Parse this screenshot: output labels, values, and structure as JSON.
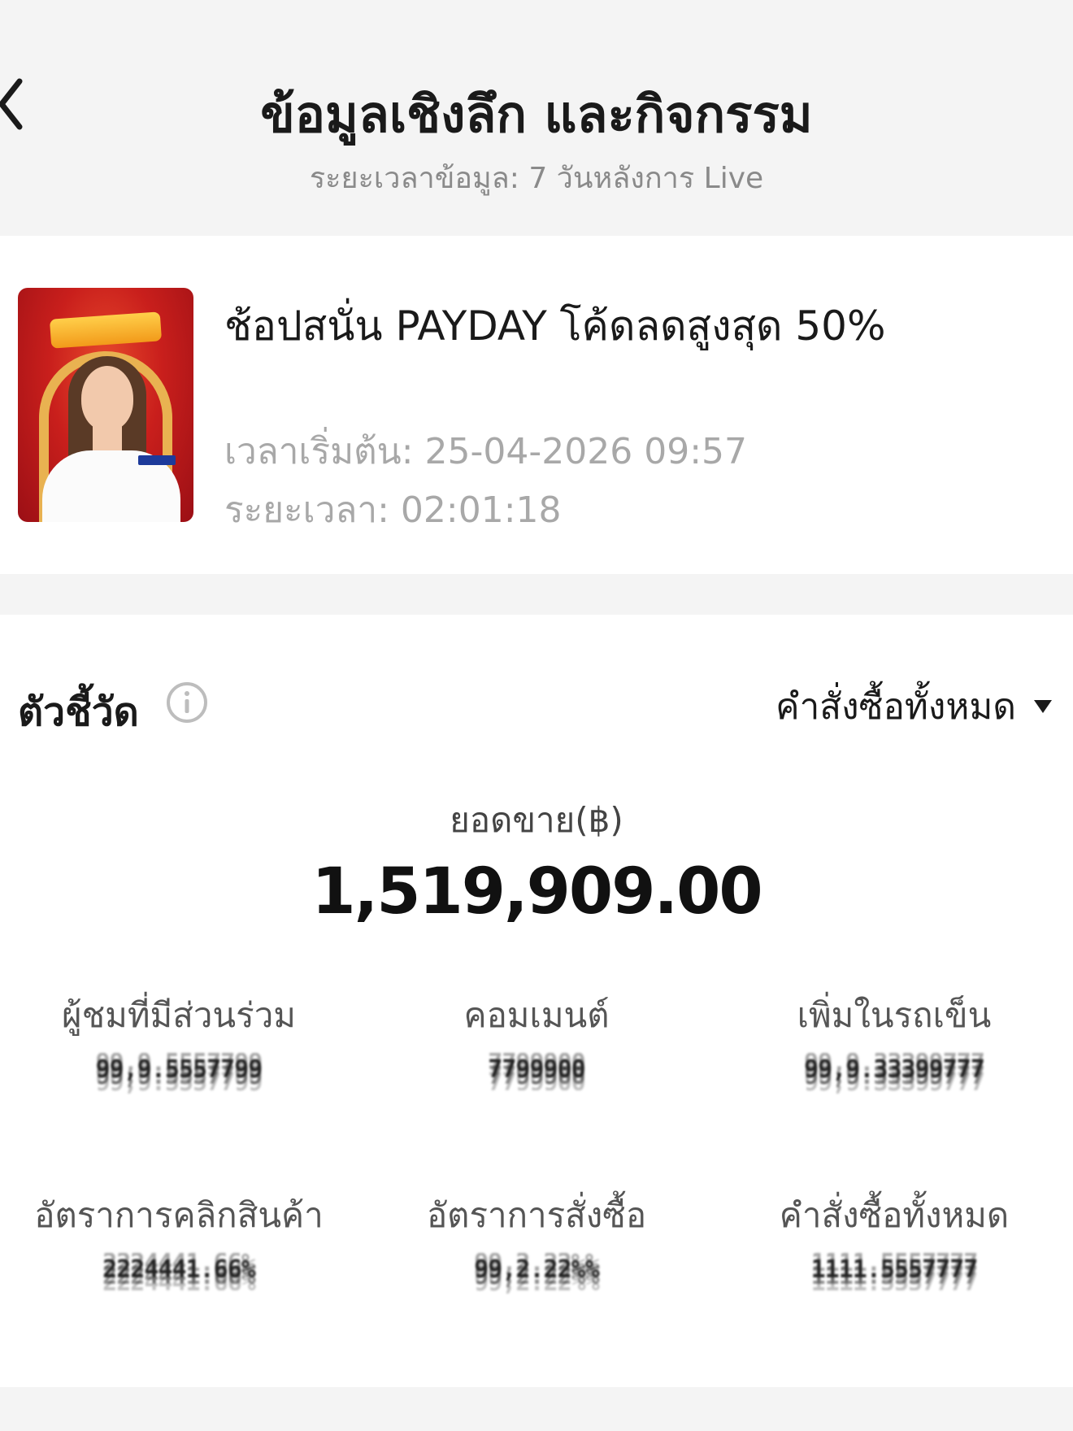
{
  "header": {
    "title": "ข้อมูลเชิงลึก และกิจกรรม",
    "subtitle": "ระยะเวลาข้อมูล: 7 วันหลังการ Live"
  },
  "live": {
    "title": "ช้อปสนั่น PAYDAY โค้ดลดสูงสุด 50%",
    "start_time": "เวลาเริ่มต้น: 25-04-2026 09:57",
    "duration": "ระยะเวลา: 02:01:18"
  },
  "metrics": {
    "label": "ตัวชี้วัด",
    "filter_label": "คำสั่งซื้อทั้งหมด",
    "sales_label": "ยอดขาย(฿)",
    "sales_value": "1,519,909.00",
    "items": [
      {
        "label": "ผู้ชมที่มีส่วนร่วม",
        "value": "99,9.5557799"
      },
      {
        "label": "คอมเมนต์",
        "value": "7799900"
      },
      {
        "label": "เพิ่มในรถเข็น",
        "value": "99,9.33399777"
      },
      {
        "label": "อัตราการคลิกสินค้า",
        "value": "2224441.66%"
      },
      {
        "label": "อัตราการสั่งซื้อ",
        "value": "99,2.22%%"
      },
      {
        "label": "คำสั่งซื้อทั้งหมด",
        "value": "1111.5557777"
      }
    ]
  },
  "colors": {
    "background": "#f4f4f4",
    "card": "#ffffff",
    "muted_text": "#8a8a8a",
    "thumbnail_red": "#c91f1c"
  }
}
